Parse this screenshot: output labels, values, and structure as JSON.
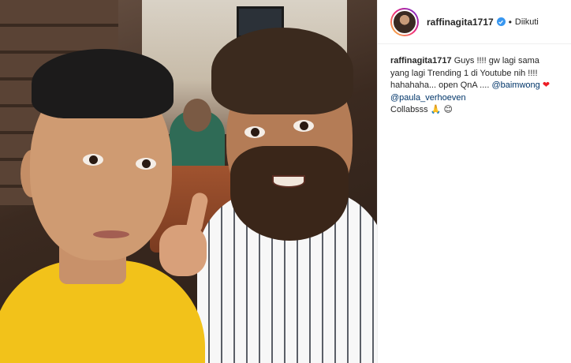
{
  "post": {
    "username": "raffinagita1717",
    "verified": true,
    "separator": "•",
    "follow_status": "Diikuti",
    "caption": {
      "username": "raffinagita1717",
      "text_part1": " Guys !!!! gw lagi sama yang lagi Trending 1 di Youtube nih !!!! hahahaha... open QnA .... ",
      "mention1": "@baimwong",
      "heart": "❤",
      "mention2": "@paula_verhoeven",
      "text_part2": "Collabsss",
      "emoji_pray": "🙏",
      "emoji_smile": "😊"
    }
  },
  "colors": {
    "verified_blue": "#3897f0",
    "mention": "#003569",
    "heart": "#ed1c24"
  }
}
